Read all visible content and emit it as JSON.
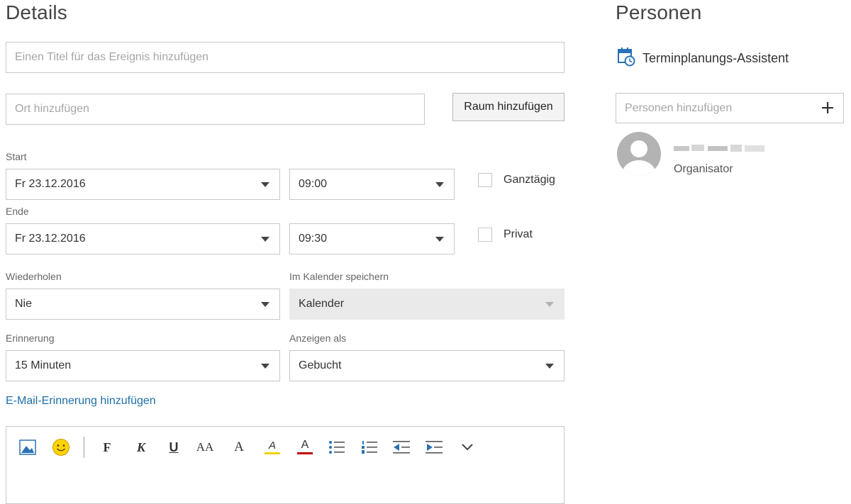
{
  "details": {
    "heading": "Details",
    "title_placeholder": "Einen Titel für das Ereignis hinzufügen",
    "location_placeholder": "Ort hinzufügen",
    "add_room_label": "Raum hinzufügen",
    "start_label": "Start",
    "start_date": "Fr 23.12.2016",
    "start_time": "09:00",
    "allday_label": "Ganztägig",
    "end_label": "Ende",
    "end_date": "Fr 23.12.2016",
    "end_time": "09:30",
    "private_label": "Privat",
    "repeat_label": "Wiederholen",
    "repeat_value": "Nie",
    "calendar_label": "Im Kalender speichern",
    "calendar_value": "Kalender",
    "reminder_label": "Erinnerung",
    "reminder_value": "15 Minuten",
    "showas_label": "Anzeigen als",
    "showas_value": "Gebucht",
    "email_reminder_link": "E-Mail-Erinnerung hinzufügen"
  },
  "toolbar": {
    "bold": "F",
    "italic": "K",
    "underline": "U",
    "font_size": "AA",
    "grow": "A",
    "highlight": "A",
    "font_color": "A"
  },
  "people": {
    "heading": "Personen",
    "scheduling_assistant": "Terminplanungs-Assistent",
    "add_people_placeholder": "Personen hinzufügen",
    "organizer_role": "Organisator"
  },
  "colors": {
    "link": "#1f6fa8",
    "calendar_icon": "#2a72b5",
    "disabled_field": "#eaeaea"
  }
}
